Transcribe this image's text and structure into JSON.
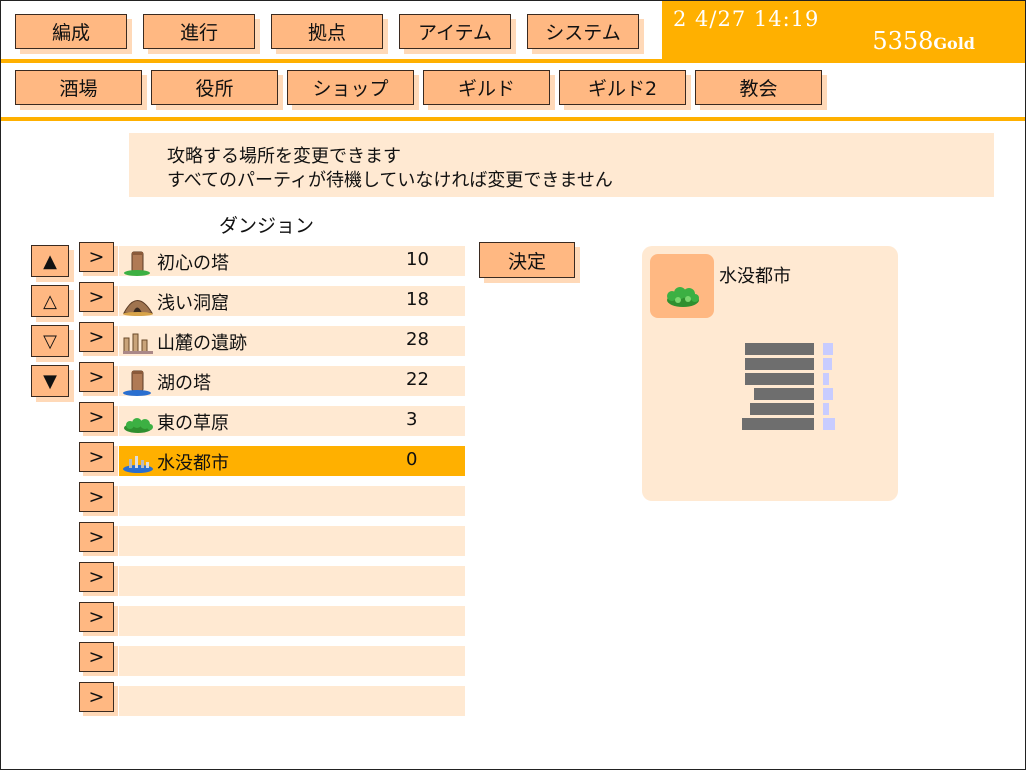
{
  "top_menu": [
    "編成",
    "進行",
    "拠点",
    "アイテム",
    "システム"
  ],
  "sub_menu": [
    "酒場",
    "役所",
    "ショップ",
    "ギルド",
    "ギルド2",
    "教会"
  ],
  "status": {
    "datetime": "2 4/27 14:19",
    "gold_amount": "5358",
    "gold_unit": "Gold"
  },
  "info": {
    "line1": "攻略する場所を変更できます",
    "line2": "すべてのパーティが待機していなければ変更できません"
  },
  "dungeon_list": {
    "title": "ダンジョン",
    "sort_buttons": [
      "▲",
      "△",
      "▽",
      "▼"
    ],
    "select_label": ">",
    "selected_index": 5,
    "rows": [
      {
        "name": "初心の塔",
        "level": "10",
        "icon": "tower-icon"
      },
      {
        "name": "浅い洞窟",
        "level": "18",
        "icon": "cave-icon"
      },
      {
        "name": "山麓の遺跡",
        "level": "28",
        "icon": "ruins-icon"
      },
      {
        "name": "湖の塔",
        "level": "22",
        "icon": "lake-tower-icon"
      },
      {
        "name": "東の草原",
        "level": "3",
        "icon": "grassland-icon"
      },
      {
        "name": "水没都市",
        "level": "0",
        "icon": "sunken-city-icon"
      },
      {
        "name": "",
        "level": "",
        "icon": ""
      },
      {
        "name": "",
        "level": "",
        "icon": ""
      },
      {
        "name": "",
        "level": "",
        "icon": ""
      },
      {
        "name": "",
        "level": "",
        "icon": ""
      },
      {
        "name": "",
        "level": "",
        "icon": ""
      },
      {
        "name": "",
        "level": "",
        "icon": ""
      }
    ]
  },
  "decide_button": "決定",
  "detail": {
    "name": "水没都市",
    "thumb_icon": "grassland-icon",
    "floors": [
      {
        "bar": 0.86,
        "indicator": 0.5
      },
      {
        "bar": 0.86,
        "indicator": 0.45
      },
      {
        "bar": 0.86,
        "indicator": 0.3
      },
      {
        "bar": 0.75,
        "indicator": 0.5
      },
      {
        "bar": 0.8,
        "indicator": 0.3
      },
      {
        "bar": 0.9,
        "indicator": 0.6
      }
    ]
  },
  "colors": {
    "accent": "#ffb000",
    "button": "#ffb882",
    "panel": "#ffe9d2",
    "bar": "#6e6e6e",
    "indicator": "#c8ccff"
  }
}
